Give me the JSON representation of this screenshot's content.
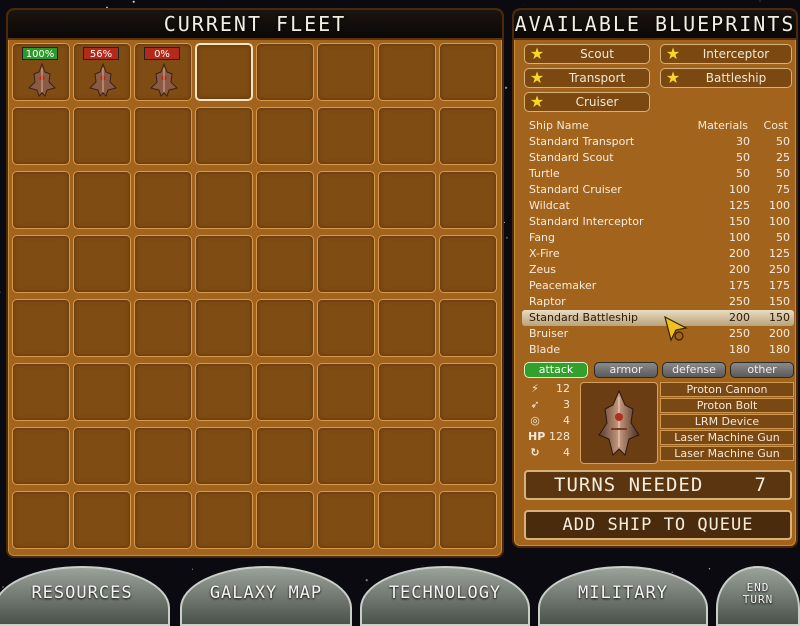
{
  "fleet": {
    "title": "CURRENT FLEET",
    "ships": [
      {
        "hp": "100%",
        "level": "high"
      },
      {
        "hp": "56%",
        "level": "low"
      },
      {
        "hp": "0%",
        "level": "low"
      }
    ]
  },
  "blueprints": {
    "title": "AVAILABLE BLUEPRINTS",
    "tabs": [
      "Scout",
      "Interceptor",
      "Transport",
      "Battleship",
      "Cruiser"
    ],
    "headers": {
      "name": "Ship  Name",
      "materials": "Materials",
      "cost": "Cost"
    },
    "ships": [
      {
        "name": "Standard  Transport",
        "materials": "30",
        "cost": "50"
      },
      {
        "name": "Standard  Scout",
        "materials": "50",
        "cost": "25"
      },
      {
        "name": "Turtle",
        "materials": "50",
        "cost": "50"
      },
      {
        "name": "Standard  Cruiser",
        "materials": "100",
        "cost": "75"
      },
      {
        "name": "Wildcat",
        "materials": "125",
        "cost": "100"
      },
      {
        "name": "Standard  Interceptor",
        "materials": "150",
        "cost": "100"
      },
      {
        "name": "Fang",
        "materials": "100",
        "cost": "50"
      },
      {
        "name": "X-Fire",
        "materials": "200",
        "cost": "125"
      },
      {
        "name": "Zeus",
        "materials": "200",
        "cost": "250"
      },
      {
        "name": "Peacemaker",
        "materials": "175",
        "cost": "175"
      },
      {
        "name": "Raptor",
        "materials": "250",
        "cost": "150"
      },
      {
        "name": "Standard  Battleship",
        "materials": "200",
        "cost": "150"
      },
      {
        "name": "Bruiser",
        "materials": "250",
        "cost": "200"
      },
      {
        "name": "Blade",
        "materials": "180",
        "cost": "180"
      }
    ],
    "selected_index": 11,
    "categories": [
      "attack",
      "armor",
      "defense",
      "other"
    ],
    "active_category": 0,
    "stats": [
      {
        "icon": "lightning-icon",
        "glyph": "⚡",
        "value": "12"
      },
      {
        "icon": "missile-icon",
        "glyph": "➶",
        "value": "3"
      },
      {
        "icon": "target-icon",
        "glyph": "◎",
        "value": "4"
      },
      {
        "icon": "hp-icon",
        "glyph": "HP",
        "value": "128"
      },
      {
        "icon": "speed-icon",
        "glyph": "↻",
        "value": "4"
      }
    ],
    "weapons": [
      "Proton  Cannon",
      "Proton  Bolt",
      "LRM  Device",
      "Laser  Machine  Gun",
      "Laser  Machine  Gun"
    ],
    "turns_label": "TURNS NEEDED",
    "turns_value": "7",
    "add_button": "ADD SHIP TO QUEUE"
  },
  "nav": {
    "resources": "RESOURCES",
    "galaxy": "GALAXY MAP",
    "technology": "TECHNOLOGY",
    "military": "MILITARY",
    "end_turn_1": "END",
    "end_turn_2": "TURN"
  },
  "colors": {
    "panel": "#a2631c",
    "slot": "#7f4c14",
    "active_tab": "#31a02c",
    "hp_high": "#2f9a2c",
    "hp_low": "#b12a1a"
  }
}
